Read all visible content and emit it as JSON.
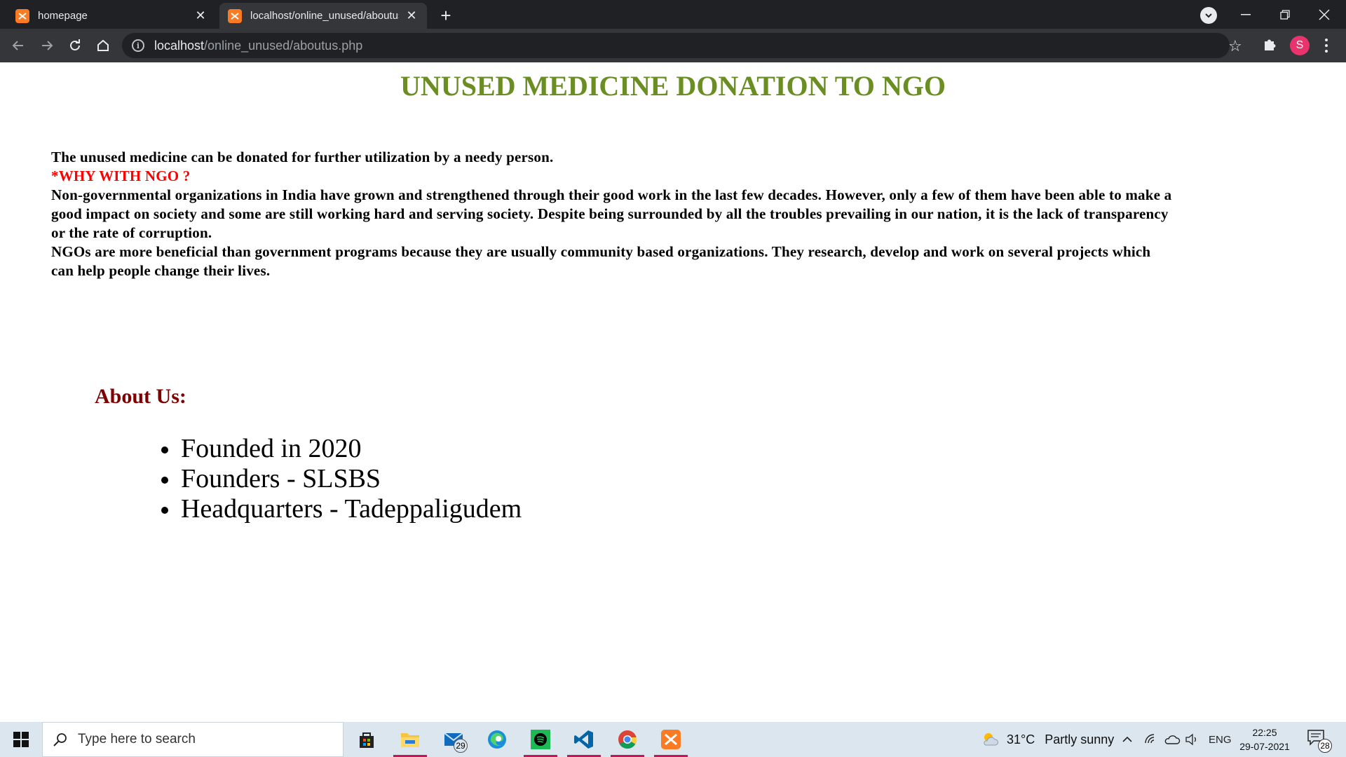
{
  "browser": {
    "tabs": [
      {
        "title": "homepage",
        "active": false
      },
      {
        "title": "localhost/online_unused/aboutus.php",
        "active": true
      }
    ],
    "address": {
      "host": "localhost",
      "path": "/online_unused/aboutus.php"
    },
    "profile_initial": "S"
  },
  "page": {
    "heading": "UNUSED MEDICINE DONATION TO NGO",
    "intro_line": "The unused medicine can be donated for further utilization by a needy person.",
    "why_title": "*WHY WITH NGO ?",
    "para1": "Non-governmental organizations in India have grown and strengthened through their good work in the last few decades. However, only a few of them have been able to make a good impact on society and some are still working hard and serving society. Despite being surrounded by all the troubles prevailing in our nation, it is the lack of transparency or the rate of corruption.",
    "para2": "NGOs are more beneficial than government programs because they are usually community based organizations. They research, develop and work on several projects which can help people change their lives.",
    "about_title": "About Us:",
    "about_items": [
      "Founded in 2020",
      "Founders - SLSBS",
      "Headquarters - Tadeppaligudem"
    ]
  },
  "taskbar": {
    "search_placeholder": "Type here to search",
    "mail_badge": "29",
    "weather": {
      "temp": "31°C",
      "condition": "Partly sunny"
    },
    "language": "ENG",
    "time": "22:25",
    "date": "29-07-2021",
    "notification_count": "28"
  },
  "colors": {
    "heading": "#6b8e23",
    "why": "#ff0000",
    "about_title": "#800000",
    "xampp_orange": "#fb7a24",
    "profile": "#e8336c"
  }
}
